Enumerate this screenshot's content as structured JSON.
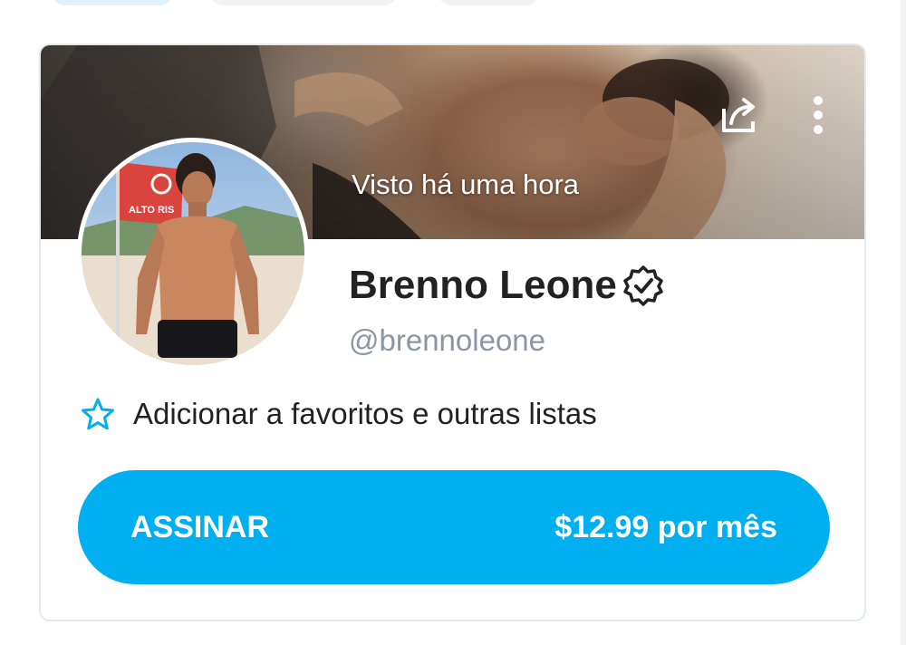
{
  "profile": {
    "last_seen": "Visto há uma hora",
    "name": "Brenno Leone",
    "handle": "@brennoleone",
    "verified": true
  },
  "actions": {
    "favorites_label": "Adicionar a favoritos e outras listas",
    "subscribe_label": "ASSINAR",
    "subscribe_price": "$12.99 por mês"
  },
  "avatar_photo": {
    "flag_text": "ALTO RIS"
  },
  "icons": {
    "share": "share-icon",
    "more": "more-vertical-icon",
    "verified": "verified-badge-icon",
    "favorite": "star-outline-icon"
  },
  "colors": {
    "accent": "#00aff0",
    "handle_gray": "#8a96a3",
    "text": "#222222"
  }
}
